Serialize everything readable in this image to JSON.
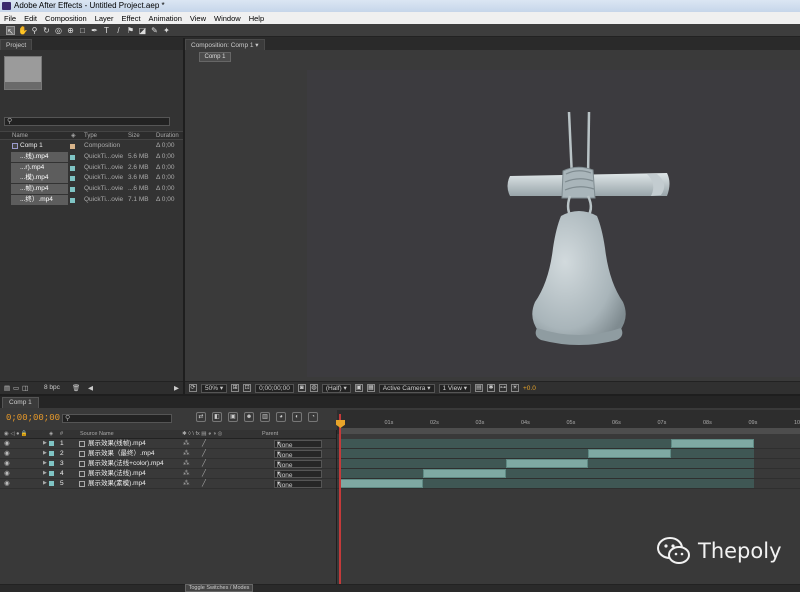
{
  "window": {
    "title": "Adobe After Effects - Untitled Project.aep *"
  },
  "menu": [
    "File",
    "Edit",
    "Composition",
    "Layer",
    "Effect",
    "Animation",
    "View",
    "Window",
    "Help"
  ],
  "project": {
    "tab": "Project",
    "columns": {
      "name": "Name",
      "type": "Type",
      "size": "Size",
      "duration": "Duration"
    },
    "items": [
      {
        "name": "Comp 1",
        "type": "Composition",
        "size": "",
        "duration": "Δ 0;00",
        "kind": "comp",
        "color": "#d8b48a"
      },
      {
        "name": "...线).mp4",
        "type": "QuickTi...ovie",
        "size": "5.6 MB",
        "duration": "Δ 0;00",
        "kind": "file",
        "color": "#7fc4c4"
      },
      {
        "name": "...r).mp4",
        "type": "QuickTi...ovie",
        "size": "2.6 MB",
        "duration": "Δ 0;00",
        "kind": "file",
        "color": "#7fc4c4"
      },
      {
        "name": "...模).mp4",
        "type": "QuickTi...ovie",
        "size": "3.6 MB",
        "duration": "Δ 0;00",
        "kind": "file",
        "color": "#7fc4c4"
      },
      {
        "name": "...帧).mp4",
        "type": "QuickTi...ovie",
        "size": "...6 MB",
        "duration": "Δ 0;00",
        "kind": "file",
        "color": "#7fc4c4"
      },
      {
        "name": "...终）.mp4",
        "type": "QuickTi...ovie",
        "size": "7.1 MB",
        "duration": "Δ 0;00",
        "kind": "file",
        "color": "#7fc4c4"
      }
    ],
    "footer": {
      "bpc": "8 bpc"
    }
  },
  "composition": {
    "tab": "Composition: Comp 1",
    "subtab": "Comp 1",
    "footer": {
      "zoom": "50%",
      "timecode": "0;00;00;00",
      "resolution": "(Half)",
      "camera": "Active Camera",
      "views": "1 View",
      "offset": "+0.0"
    }
  },
  "timeline": {
    "tab": "Comp 1",
    "timecode": "0;00;00;00",
    "columns": {
      "num": "#",
      "source": "Source Name",
      "parent": "Parent"
    },
    "ruler": [
      "0s",
      "01s",
      "02s",
      "03s",
      "04s",
      "05s",
      "06s",
      "07s",
      "08s",
      "09s",
      "10s"
    ],
    "layers": [
      {
        "num": "1",
        "name": "展示效果(线帧).mp4",
        "parent": "None",
        "color": "#7fc4c4",
        "start": 0.8,
        "end": 1.0
      },
      {
        "num": "2",
        "name": "展示效果（最终）.mp4",
        "parent": "None",
        "color": "#7fc4c4",
        "start": 0.6,
        "end": 0.8
      },
      {
        "num": "3",
        "name": "展示效果(法线+color).mp4",
        "parent": "None",
        "color": "#7fc4c4",
        "start": 0.4,
        "end": 0.6
      },
      {
        "num": "4",
        "name": "展示效果(法线).mp4",
        "parent": "None",
        "color": "#7fc4c4",
        "start": 0.2,
        "end": 0.4
      },
      {
        "num": "5",
        "name": "展示效果(素模).mp4",
        "parent": "None",
        "color": "#7fc4c4",
        "start": 0.0,
        "end": 0.2
      }
    ],
    "footer": {
      "toggle": "Toggle Switches / Modes"
    }
  },
  "watermark": {
    "text": "Thepoly"
  }
}
